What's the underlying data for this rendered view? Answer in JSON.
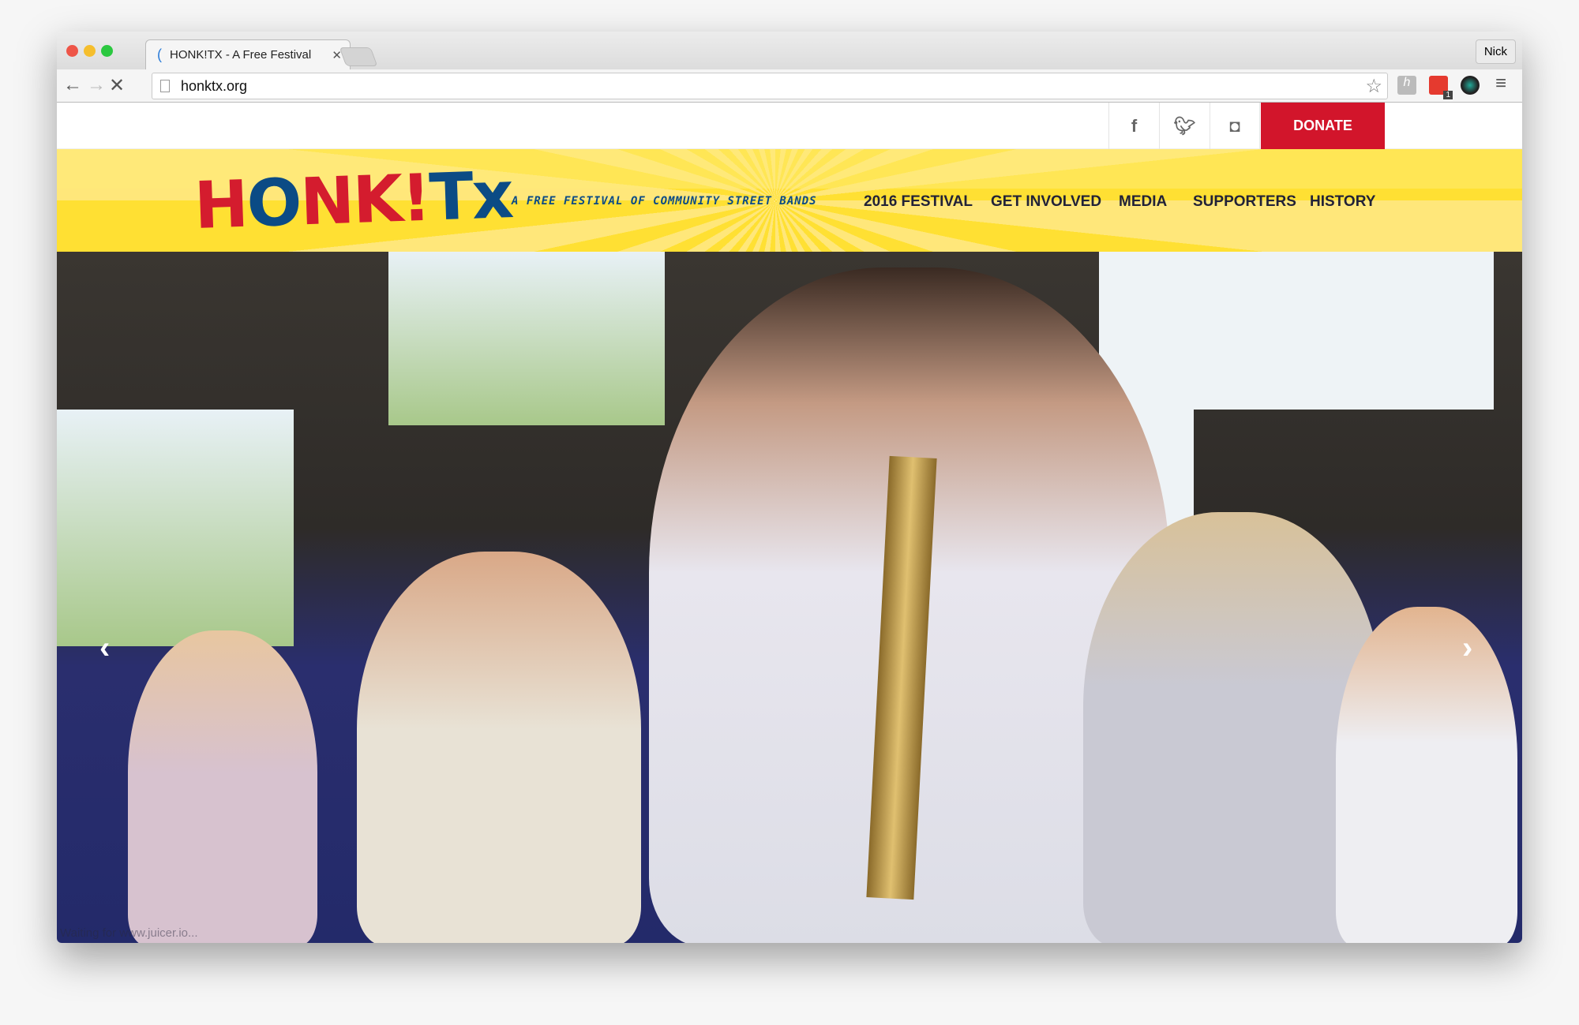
{
  "browser": {
    "tab_title": "HONK!TX - A Free Festival",
    "url": "honktx.org",
    "user": "Nick",
    "extension_badge": "1",
    "status_text": "Waiting for www.juicer.io..."
  },
  "topbar": {
    "social": [
      "facebook-icon",
      "twitter-icon",
      "instagram-icon"
    ],
    "donate_label": "DONATE"
  },
  "header": {
    "logo_text": "HONK!TX",
    "tagline": "A FREE FESTIVAL OF COMMUNITY STREET BANDS",
    "nav": [
      "2016 FESTIVAL",
      "GET INVOLVED",
      "MEDIA",
      "SUPPORTERS",
      "HISTORY"
    ]
  },
  "hero": {
    "prev": "‹",
    "next": "›"
  },
  "colors": {
    "yellow": "#ffe033",
    "red": "#d2152b",
    "blue": "#0b4b85"
  }
}
